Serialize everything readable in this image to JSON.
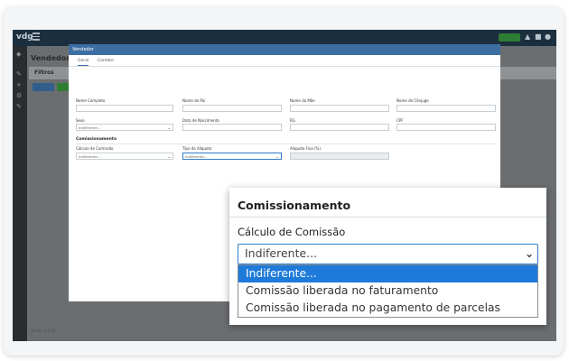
{
  "background_app": {
    "logo": "vdg",
    "page_title": "Vendedores",
    "filter_label": "Filtros",
    "footer": "Versão 3.0.22",
    "icons": [
      "menu-icon",
      "bell-icon",
      "mail-icon",
      "user-icon"
    ]
  },
  "modal": {
    "title": "Vendedor",
    "tabs": [
      {
        "label": "Geral"
      },
      {
        "label": "Contato"
      }
    ],
    "fields": {
      "nome_completo": {
        "label": "Nome Completo",
        "value": ""
      },
      "nome_pai": {
        "label": "Nome do Pai",
        "value": ""
      },
      "nome_mae": {
        "label": "Nome da Mãe",
        "value": ""
      },
      "nome_conjuge": {
        "label": "Nome do Cônjuge",
        "value": ""
      },
      "sexo": {
        "label": "Sexo",
        "value": "Indiferente..."
      },
      "data_nascimento": {
        "label": "Data de Nascimento",
        "value": ""
      },
      "rg": {
        "label": "RG",
        "value": ""
      },
      "cpf": {
        "label": "CPF",
        "value": ""
      }
    },
    "commission_section": {
      "title": "Comissionamento",
      "calculo_label": "Cálculo de Comissão",
      "calculo_value": "Indiferente...",
      "tipo_aliquota_label": "Tipo da Alíquota",
      "tipo_aliquota_value": "Indiferente...",
      "aliquota_fixa_label": "Alíquota Fixa (%)",
      "aliquota_fixa_value": ""
    }
  },
  "zoom_panel": {
    "section_title": "Comissionamento",
    "field_label": "Cálculo de Comissão",
    "selected_value": "Indiferente...",
    "options": [
      {
        "label": "Indiferente...",
        "selected": true
      },
      {
        "label": "Comissão liberada no faturamento",
        "selected": false
      },
      {
        "label": "Comissão liberada no pagamento de parcelas",
        "selected": false
      }
    ]
  },
  "colors": {
    "accent": "#1e7bd9",
    "header": "#3d6ea3",
    "topbar": "#1c2f3f"
  }
}
